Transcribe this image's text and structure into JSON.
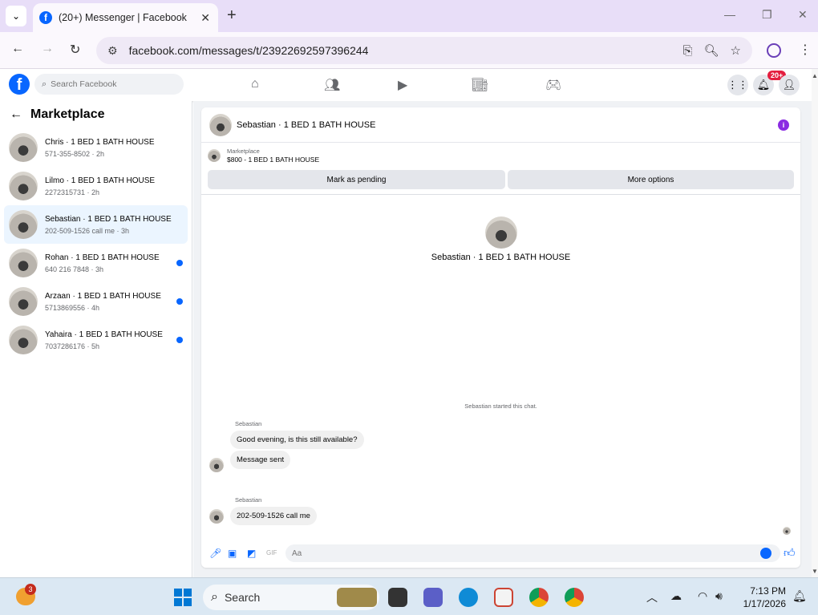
{
  "browser": {
    "tab_title": "(20+) Messenger | Facebook",
    "url": "facebook.com/messages/t/23922692597396244"
  },
  "facebook": {
    "search_placeholder": "Search Facebook",
    "notification_badge": "20+",
    "brand_color": "#0866ff"
  },
  "sidebar": {
    "title": "Marketplace",
    "conversations": [
      {
        "name": "Chris · 1 BED 1 BATH HOUSE",
        "sub": "571-355-8502 · 2h",
        "unread": false,
        "active": false
      },
      {
        "name": "Lilmo · 1 BED 1 BATH HOUSE",
        "sub": "2272315731 · 2h",
        "unread": false,
        "active": false
      },
      {
        "name": "Sebastian · 1 BED 1 BATH HOUSE",
        "sub": "202-509-1526 call me · 3h",
        "unread": false,
        "active": true
      },
      {
        "name": "Rohan · 1 BED 1 BATH HOUSE",
        "sub": "640 216 7848 · 3h",
        "unread": true,
        "active": false
      },
      {
        "name": "Arzaan · 1 BED 1 BATH HOUSE",
        "sub": "5713869556 · 4h",
        "unread": true,
        "active": false
      },
      {
        "name": "Yahaira · 1 BED 1 BATH HOUSE",
        "sub": "7037286176 · 5h",
        "unread": true,
        "active": false
      }
    ]
  },
  "chat": {
    "title": "Sebastian · 1 BED 1 BATH HOUSE",
    "marketplace_label": "Marketplace",
    "listing": "$800 - 1 BED 1 BATH HOUSE",
    "mark_pending": "Mark as pending",
    "more_options": "More options",
    "center_name": "Sebastian · 1 BED 1 BATH HOUSE",
    "started_text": "Sebastian started this chat.",
    "messages": [
      {
        "sender": "Sebastian",
        "text": "Good evening, is this still available?"
      },
      {
        "sender": "",
        "text": "Message sent"
      },
      {
        "sender": "Sebastian",
        "text": "202-509-1526 call me"
      }
    ],
    "composer_placeholder": "Aa"
  },
  "taskbar": {
    "weather_badge": "3",
    "search_label": "Search",
    "time": "7:13 PM",
    "date": "1/17/2026"
  }
}
